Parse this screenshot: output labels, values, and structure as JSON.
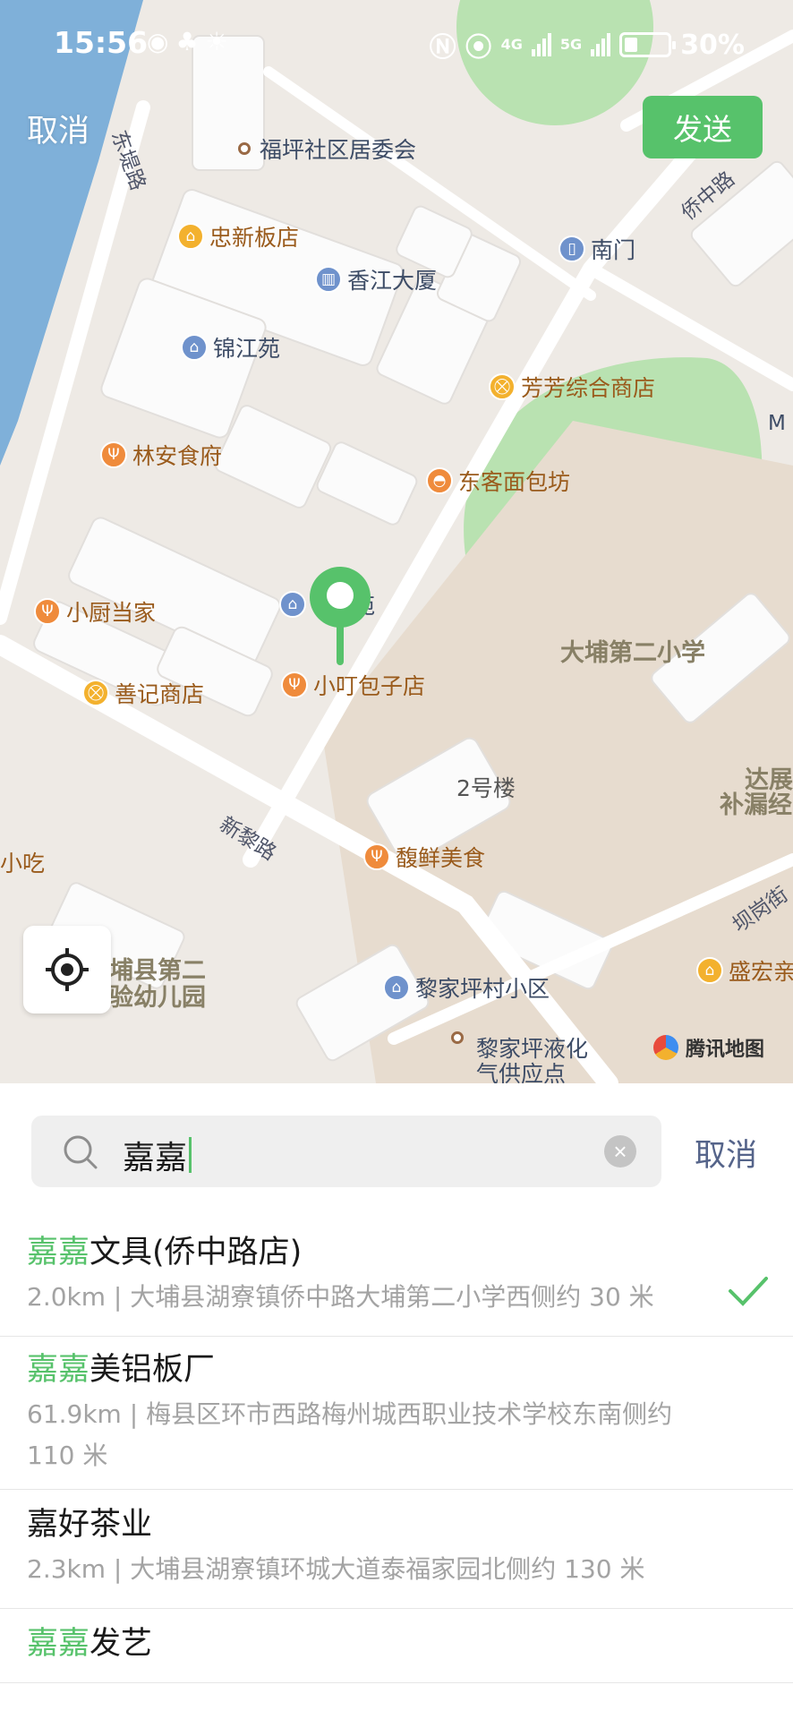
{
  "status_bar": {
    "time": "15:56",
    "network_left": "4G",
    "network_right": "5G",
    "battery": "30%",
    "battery_level": 0.3
  },
  "header": {
    "cancel_label": "取消",
    "send_label": "发送"
  },
  "map": {
    "pois": [
      {
        "name": "福坪社区居委会",
        "kind": "small"
      },
      {
        "name": "忠新板店",
        "kind": "shop"
      },
      {
        "name": "香江大厦",
        "kind": "blue"
      },
      {
        "name": "南门",
        "kind": "blue"
      },
      {
        "name": "锦江苑",
        "kind": "blue"
      },
      {
        "name": "芳芳综合商店",
        "kind": "shop"
      },
      {
        "name": "林安食府",
        "kind": "food"
      },
      {
        "name": "东客面包坊",
        "kind": "food"
      },
      {
        "name": "小厨当家",
        "kind": "food"
      },
      {
        "name": "苑",
        "kind": "blue"
      },
      {
        "name": "善记商店",
        "kind": "shop"
      },
      {
        "name": "小叮包子店",
        "kind": "food"
      },
      {
        "name": "馥鲜美食",
        "kind": "food"
      },
      {
        "name": "黎家坪村小区",
        "kind": "blue"
      },
      {
        "name": "盛宏亲",
        "kind": "shop"
      }
    ],
    "roads": [
      "东堤路",
      "侨中路",
      "新黎路",
      "坝岗街"
    ],
    "areas": [
      "大埔第二小学",
      "2号楼",
      "达展",
      "补漏经",
      "小吃",
      "埔县第二",
      "验幼儿园",
      "黎家坪液化",
      "气供应点",
      "M"
    ],
    "logo": "腾讯地图",
    "accent": "#57c26b"
  },
  "search": {
    "query": "嘉嘉",
    "cancel_label": "取消"
  },
  "results": [
    {
      "highlight": "嘉嘉",
      "rest": "文具(侨中路店)",
      "address": "2.0km | 大埔县湖寮镇侨中路大埔第二小学西侧约 30 米",
      "selected": true
    },
    {
      "highlight": "嘉嘉",
      "rest": "美铝板厂",
      "address": "61.9km | 梅县区环市西路梅州城西职业技术学校东南侧约 110 米",
      "selected": false
    },
    {
      "highlight": "",
      "rest": "嘉好茶业",
      "address": "2.3km | 大埔县湖寮镇环城大道泰福家园北侧约 130 米",
      "selected": false
    },
    {
      "highlight": "嘉嘉",
      "rest": "发艺",
      "address": "",
      "selected": false
    }
  ]
}
